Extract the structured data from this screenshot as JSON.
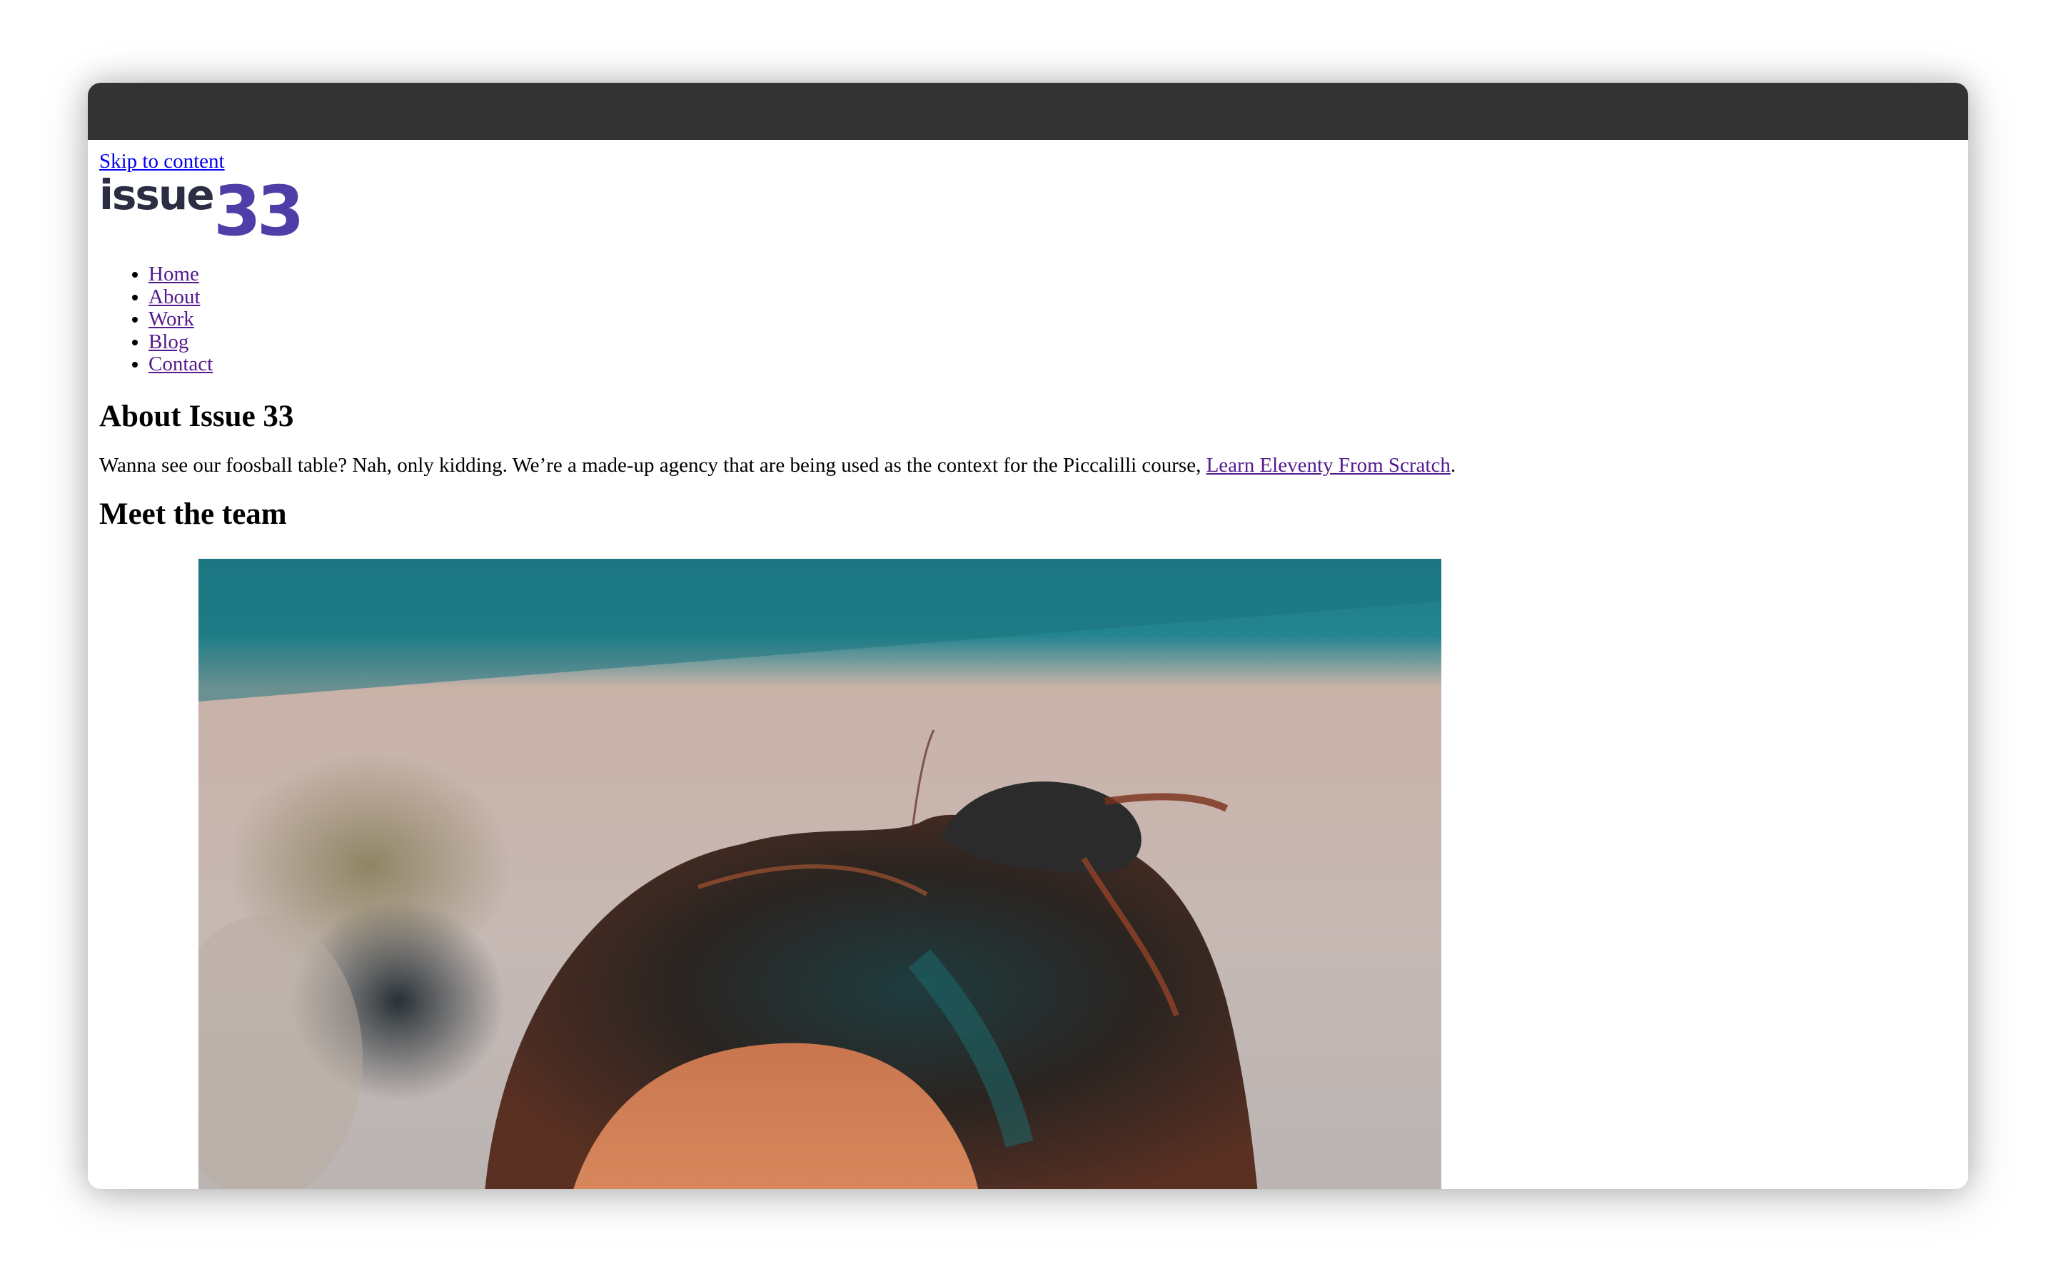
{
  "page": {
    "skip_link": "Skip to content",
    "logo": {
      "word": "issue",
      "number": "33",
      "colors": {
        "word": "#2b2d42",
        "number": "#4d3ea8"
      }
    },
    "nav": {
      "items": [
        "Home",
        "About",
        "Work",
        "Blog",
        "Contact"
      ]
    },
    "heading": "About Issue 33",
    "intro": {
      "text": "Wanna see our foosball table? Nah, only kidding. We’re a made-up agency that are being used as the context for the Piccalilli course, ",
      "link": "Learn Eleventy From Scratch",
      "suffix": "."
    },
    "team_heading": "Meet the team",
    "photo_icon": "team-member-photo"
  },
  "colors": {
    "titlebar": "#333333",
    "visited_link": "#551a8b",
    "link": "#0000ee"
  }
}
